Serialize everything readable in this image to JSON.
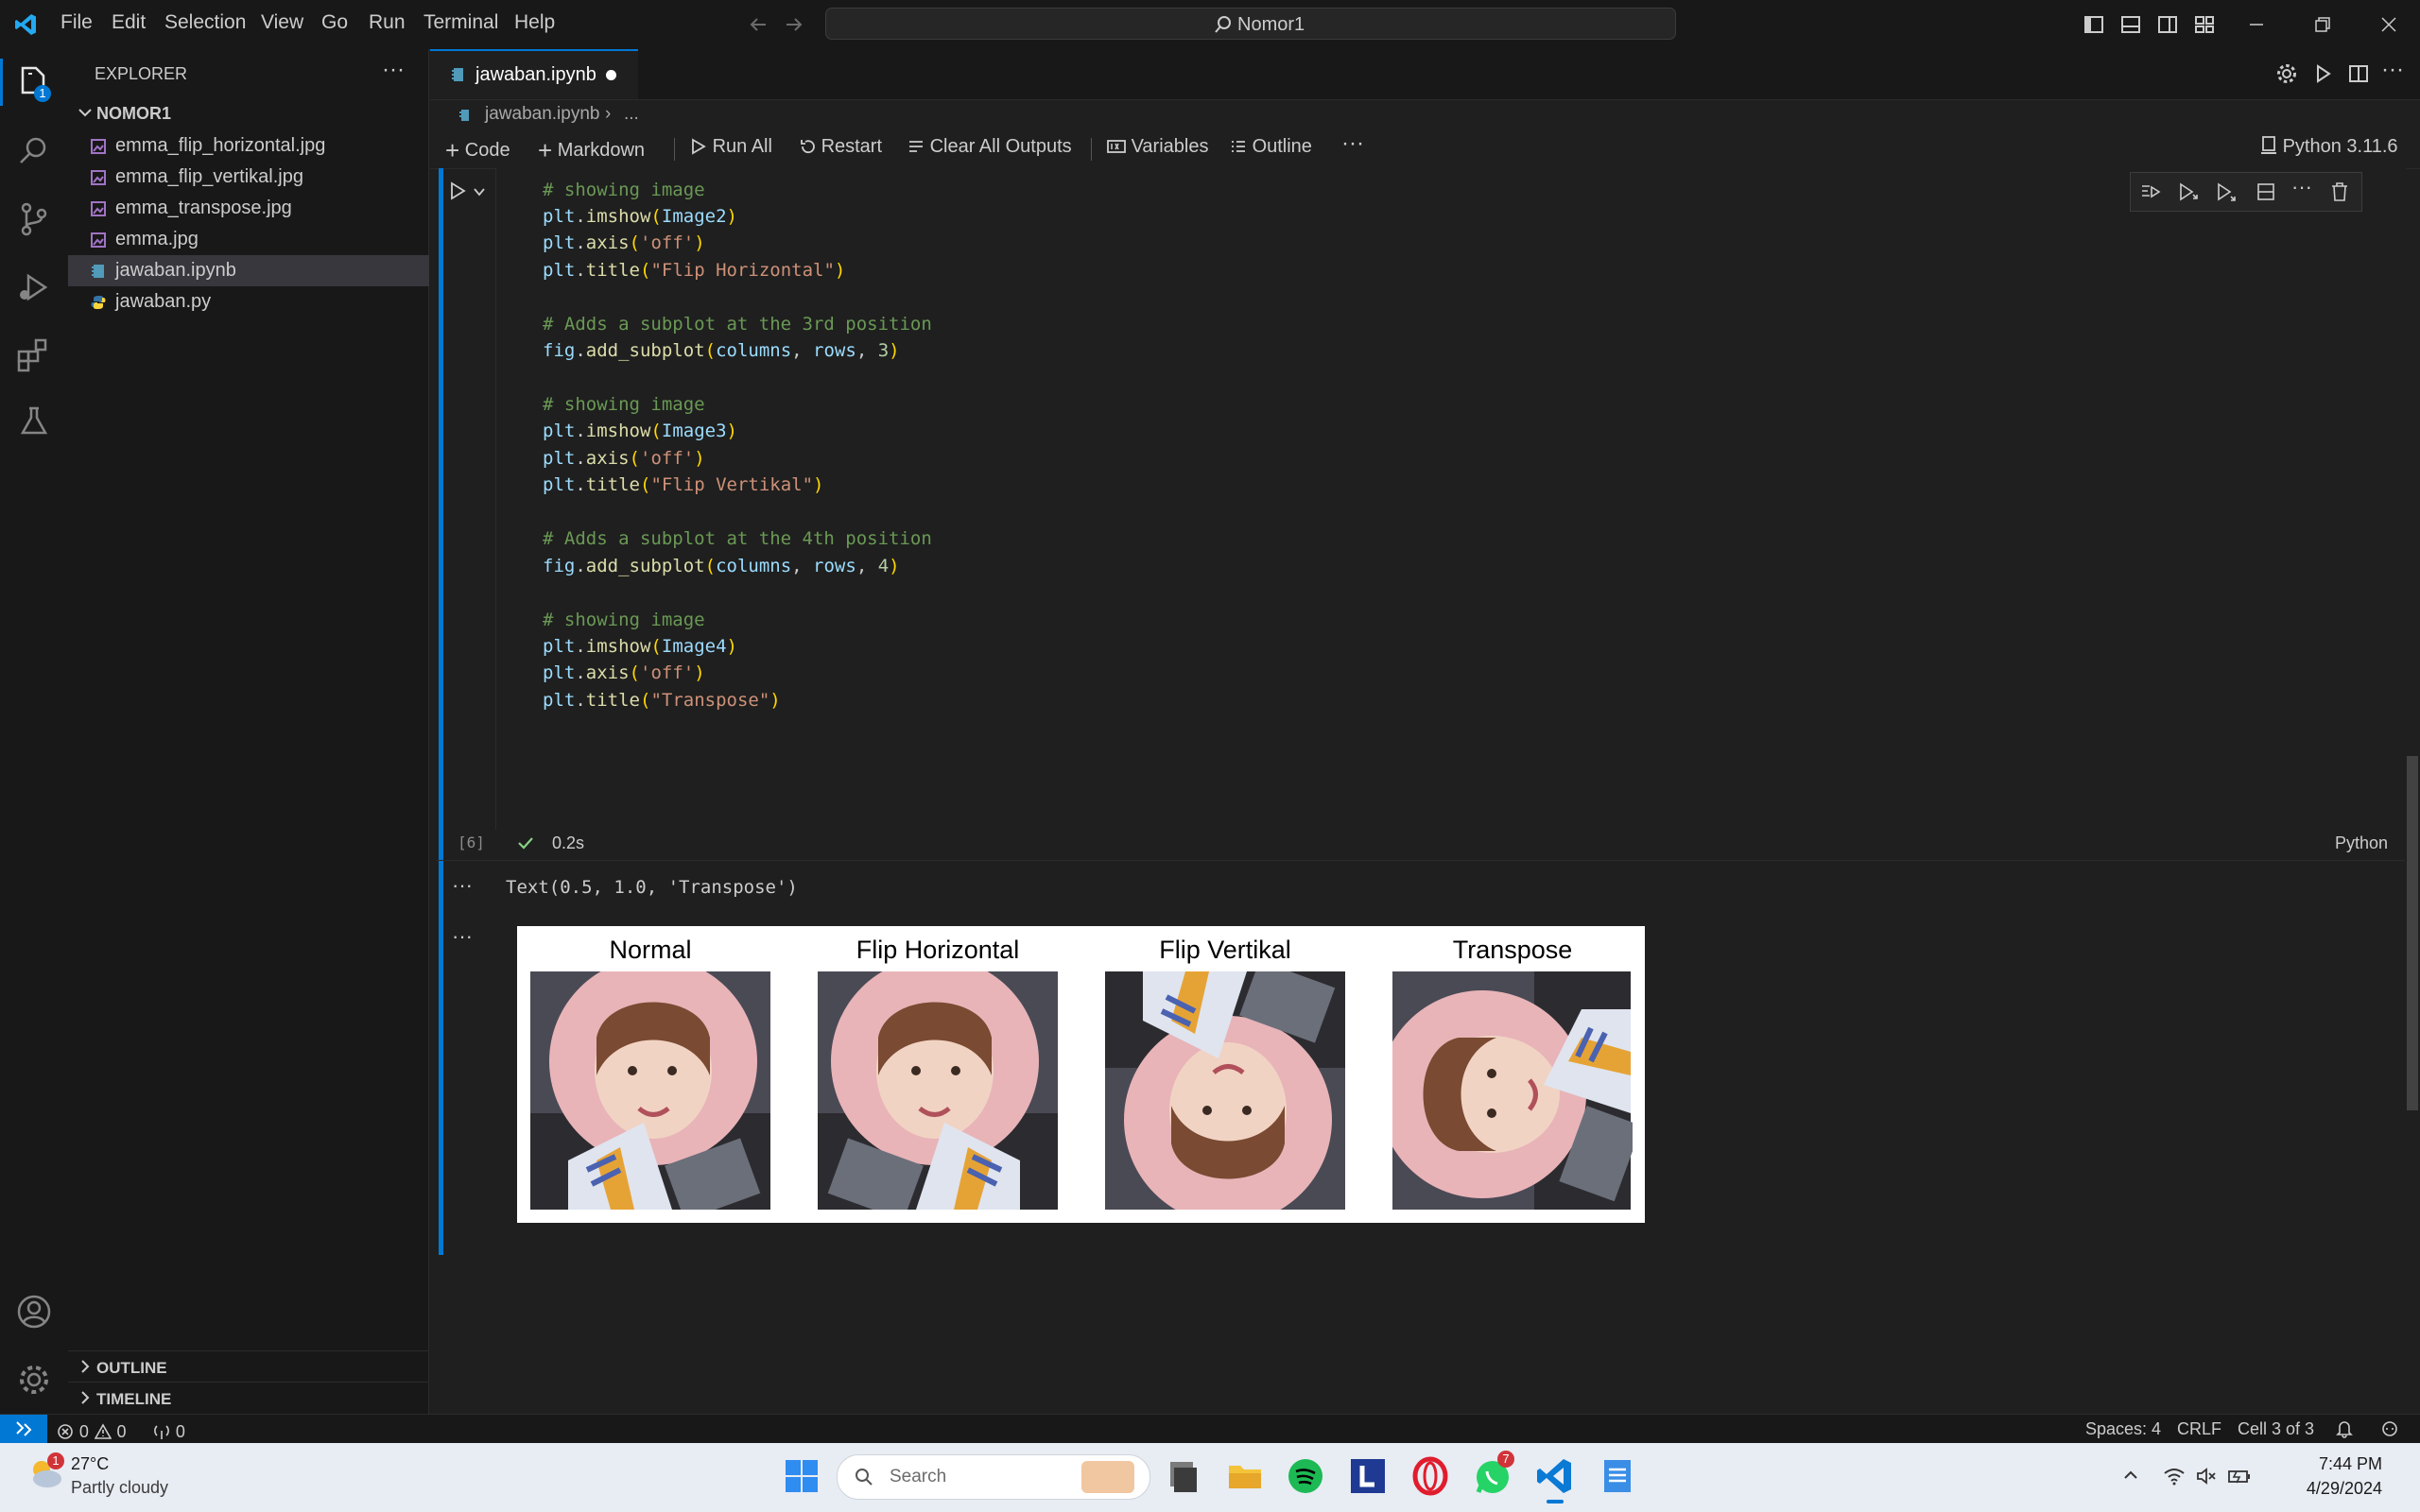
{
  "titlebar": {
    "menu": [
      "File",
      "Edit",
      "Selection",
      "View",
      "Go",
      "Run",
      "Terminal",
      "Help"
    ],
    "search_text": "Nomor1"
  },
  "activity": {
    "explorer_badge": "1"
  },
  "sidebar": {
    "title": "EXPLORER",
    "folder": "NOMOR1",
    "files": [
      {
        "name": "emma_flip_horizontal.jpg",
        "type": "image"
      },
      {
        "name": "emma_flip_vertikal.jpg",
        "type": "image"
      },
      {
        "name": "emma_transpose.jpg",
        "type": "image"
      },
      {
        "name": "emma.jpg",
        "type": "image"
      },
      {
        "name": "jawaban.ipynb",
        "type": "notebook",
        "selected": true
      },
      {
        "name": "jawaban.py",
        "type": "python"
      }
    ],
    "outline_label": "OUTLINE",
    "timeline_label": "TIMELINE"
  },
  "editor": {
    "tab_label": "jawaban.ipynb",
    "breadcrumb_file": "jawaban.ipynb",
    "breadcrumb_more": "...",
    "toolbar": {
      "code": "Code",
      "markdown": "Markdown",
      "run_all": "Run All",
      "restart": "Restart",
      "clear_outputs": "Clear All Outputs",
      "variables": "Variables",
      "outline": "Outline",
      "kernel": "Python 3.11.6"
    },
    "cell": {
      "exec_count": "[6]",
      "duration": "0.2s",
      "language": "Python",
      "code": {
        "l1": "# showing image",
        "l2_fn": "plt.imshow(",
        "l2_arg": "Image2",
        "l3_arg": "'off'",
        "l4_arg": "\"Flip Horizontal\"",
        "l5": "# Adds a subplot at the 3rd position",
        "l6_num": "3",
        "l7": "# showing image",
        "l8_arg": "Image3",
        "l9_arg": "'off'",
        "l10_arg": "\"Flip Vertikal\"",
        "l11": "# Adds a subplot at the 4th position",
        "l12_num": "4",
        "l13": "# showing image",
        "l14_arg": "Image4",
        "l15_arg": "'off'",
        "l16_arg": "\"Transpose\""
      },
      "output_text": "Text(0.5, 1.0, 'Transpose')",
      "panels": [
        "Normal",
        "Flip Horizontal",
        "Flip Vertikal",
        "Transpose"
      ]
    }
  },
  "statusbar": {
    "errors": "0",
    "warnings": "0",
    "ports": "0",
    "spaces": "Spaces: 4",
    "eol": "CRLF",
    "cell_pos": "Cell 3 of 3"
  },
  "taskbar": {
    "weather_temp": "27°C",
    "weather_desc": "Partly cloudy",
    "weather_badge": "1",
    "search_placeholder": "Search",
    "whatsapp_badge": "7",
    "time": "7:44 PM",
    "date": "4/29/2024"
  },
  "colors": {
    "accent": "#0078d4",
    "background": "#1f1f1f"
  }
}
